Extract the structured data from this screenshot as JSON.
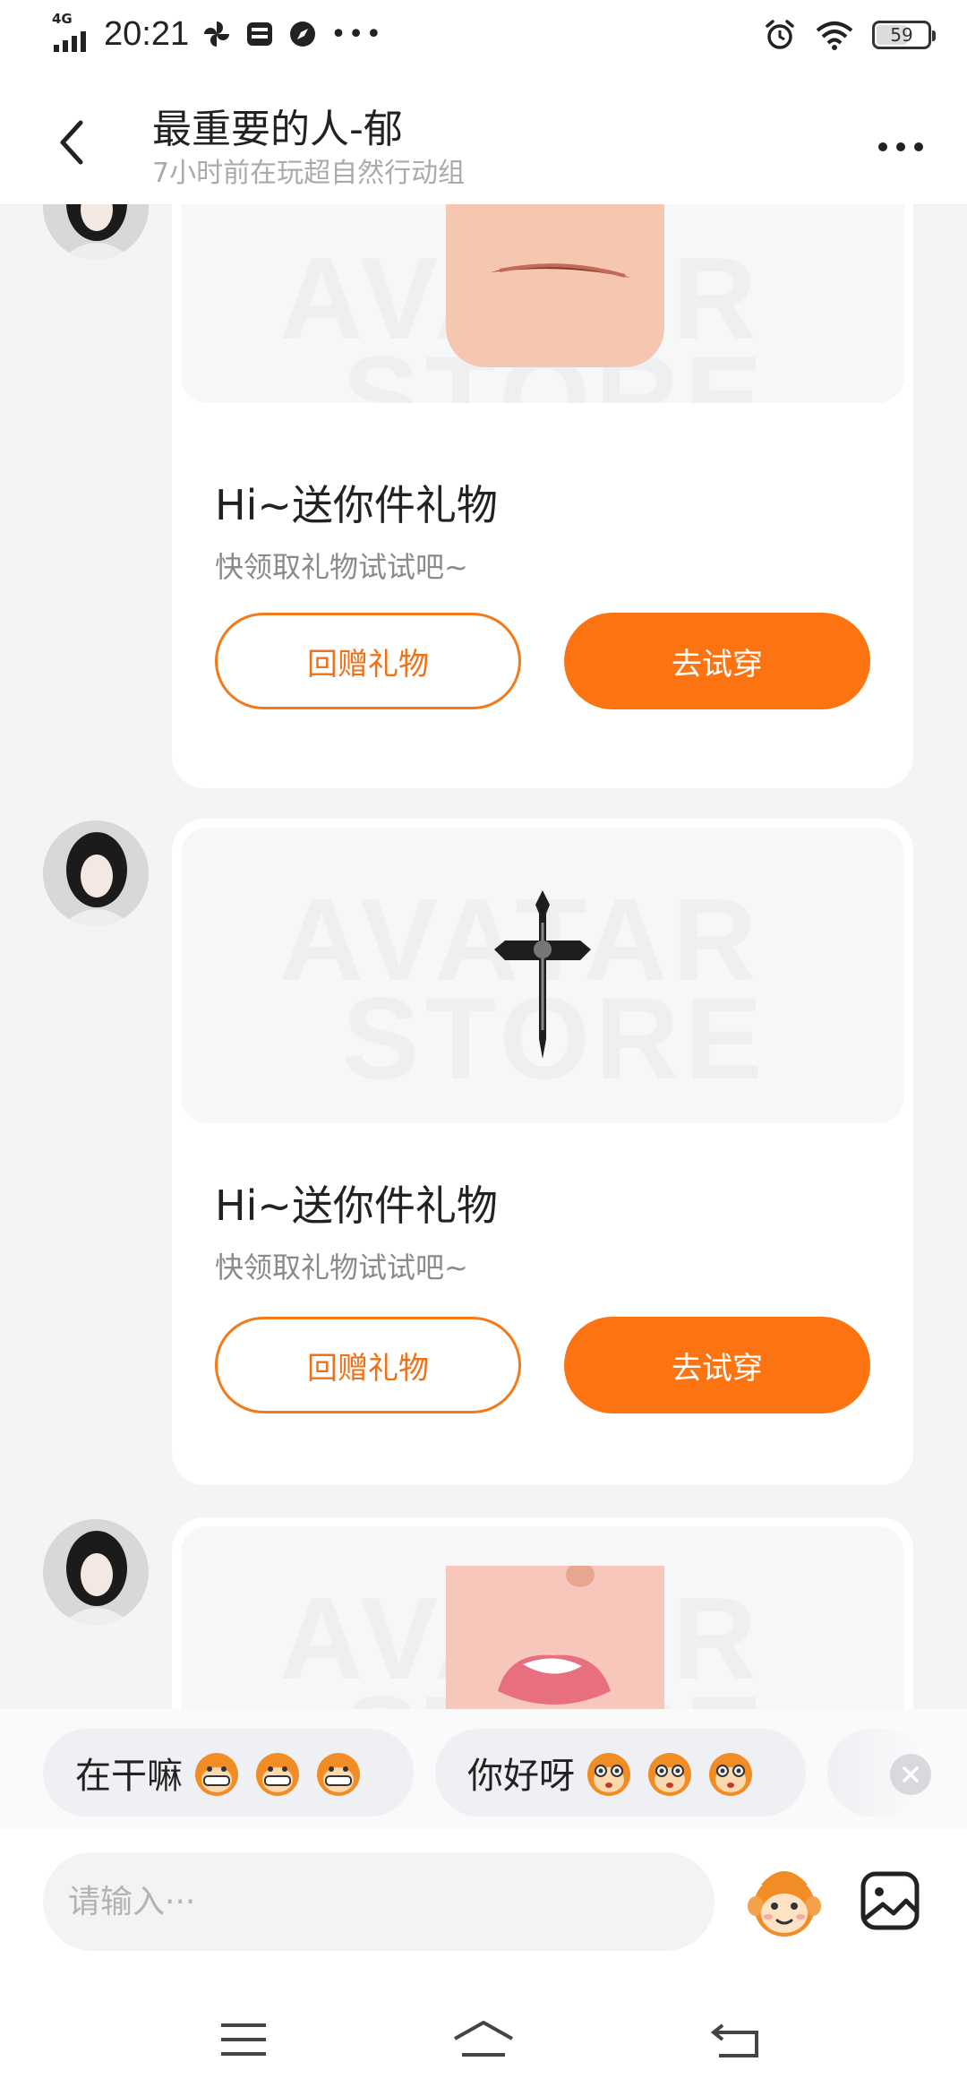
{
  "status_bar": {
    "network": "4G",
    "time": "20:21",
    "battery": "59"
  },
  "header": {
    "title": "最重要的人-郁",
    "subtitle": "7小时前在玩超自然行动组"
  },
  "messages": [
    {
      "card_title": "Hi~送你件礼物",
      "card_sub": "快领取礼物试试吧~",
      "return_gift_label": "回赠礼物",
      "try_on_label": "去试穿",
      "watermark": [
        "AVATAR",
        "STORE"
      ]
    },
    {
      "card_title": "Hi~送你件礼物",
      "card_sub": "快领取礼物试试吧~",
      "return_gift_label": "回赠礼物",
      "try_on_label": "去试穿",
      "watermark": [
        "AVATAR",
        "STORE"
      ]
    },
    {
      "watermark": [
        "AVATAR",
        "STORE"
      ]
    }
  ],
  "quick_replies": [
    {
      "text": "在干嘛",
      "emoji": "grinning-monkey-emoji"
    },
    {
      "text": "你好呀",
      "emoji": "surprised-monkey-emoji"
    }
  ],
  "input": {
    "placeholder": "请输入···"
  },
  "colors": {
    "accent": "#fc7412",
    "background": "#f3f4f6"
  }
}
